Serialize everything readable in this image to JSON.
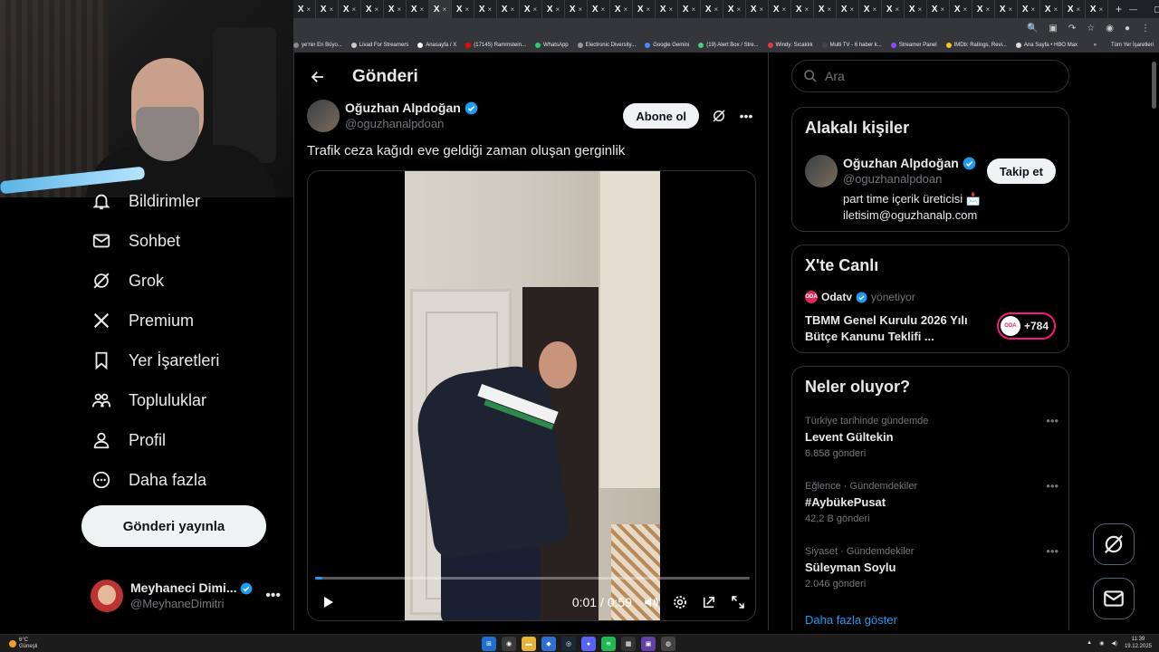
{
  "browser": {
    "tab_label": "X",
    "tab_count": 36,
    "tab_plus": "+",
    "bookmarks": [
      {
        "label": "ye'nin En Büyo...",
        "color": "#888"
      },
      {
        "label": "Livad For Streamers",
        "color": "#ccc"
      },
      {
        "label": "Anasayfa / X",
        "color": "#fff"
      },
      {
        "label": "(17145) Rammstein...",
        "color": "#f00"
      },
      {
        "label": "WhatsApp",
        "color": "#25d366"
      },
      {
        "label": "Electronic Diversity...",
        "color": "#999"
      },
      {
        "label": "Google Gemini",
        "color": "#4a8cf7"
      },
      {
        "label": "(19) Alert Box / Stre...",
        "color": "#44cc88"
      },
      {
        "label": "Windy: Sıcaklık",
        "color": "#e03c3c"
      },
      {
        "label": "Multi TV - 6 haber k...",
        "color": "#444"
      },
      {
        "label": "Streamer Panel",
        "color": "#9146ff"
      },
      {
        "label": "IMDb: Ratings, Revi...",
        "color": "#f5c518"
      },
      {
        "label": "Ana Sayfa • HBO Max",
        "color": "#ddd"
      }
    ],
    "bookmarks_more": "»",
    "all_bookmarks": "Tüm Yer İşaretleri"
  },
  "nav": {
    "items": [
      {
        "label": "Bildirimler",
        "icon": "bell-icon"
      },
      {
        "label": "Sohbet",
        "icon": "mail-icon"
      },
      {
        "label": "Grok",
        "icon": "grok-icon"
      },
      {
        "label": "Premium",
        "icon": "x-logo-icon"
      },
      {
        "label": "Yer İşaretleri",
        "icon": "bookmark-icon"
      },
      {
        "label": "Topluluklar",
        "icon": "people-icon"
      },
      {
        "label": "Profil",
        "icon": "person-icon"
      },
      {
        "label": "Daha fazla",
        "icon": "more-circle-icon"
      }
    ],
    "post_button": "Gönderi yayınla",
    "account": {
      "name": "Meyhaneci Dimi...",
      "handle": "@MeyhaneDimitri",
      "more": "•••"
    }
  },
  "main": {
    "title": "Gönderi",
    "post": {
      "author_name": "Oğuzhan Alpdoğan",
      "author_handle": "@oguzhanalpdoan",
      "subscribe_label": "Abone ol",
      "more": "•••",
      "text": "Trafik ceza kağıdı eve geldiği zaman oluşan gerginlik",
      "video": {
        "current_time": "0:01",
        "duration": "0:59",
        "time_display": "0:01 / 0:59",
        "progress_fraction": 0.017
      }
    }
  },
  "sidebar": {
    "search_placeholder": "Ara",
    "related": {
      "title": "Alakalı kişiler",
      "name": "Oğuzhan Alpdoğan",
      "handle": "@oguzhanalpdoan",
      "bio_line1": "part time içerik üreticisi 📩",
      "bio_line2": "iletisim@oguzhanalp.com",
      "follow_label": "Takip et"
    },
    "live": {
      "title": "X'te Canlı",
      "host_logo": "ODA",
      "host": "Odatv",
      "role": "yönetiyor",
      "event_title": "TBMM Genel Kurulu 2026 Yılı Bütçe Kanunu Teklifi ...",
      "listener_count": "+784"
    },
    "trends": {
      "title": "Neler oluyor?",
      "items": [
        {
          "context": "Türkiye tarihinde gündemde",
          "name": "Levent Gültekin",
          "count": "6.858 gönderi"
        },
        {
          "context": "Eğlence · Gündemdekiler",
          "name": "#AybükePusat",
          "count": "42,2 B gönderi"
        },
        {
          "context": "Siyaset · Gündemdekiler",
          "name": "Süleyman Soylu",
          "count": "2.046 gönderi"
        }
      ],
      "more": "•••",
      "show_more": "Daha fazla göster"
    }
  },
  "taskbar": {
    "weather_temp": "6°C",
    "weather_desc": "Güneşli",
    "time": "11:39",
    "date": "19.12.2025"
  },
  "colors": {
    "accent": "#1d9bf0",
    "live_pink": "#f91880",
    "verified": "#1d9bf0"
  }
}
